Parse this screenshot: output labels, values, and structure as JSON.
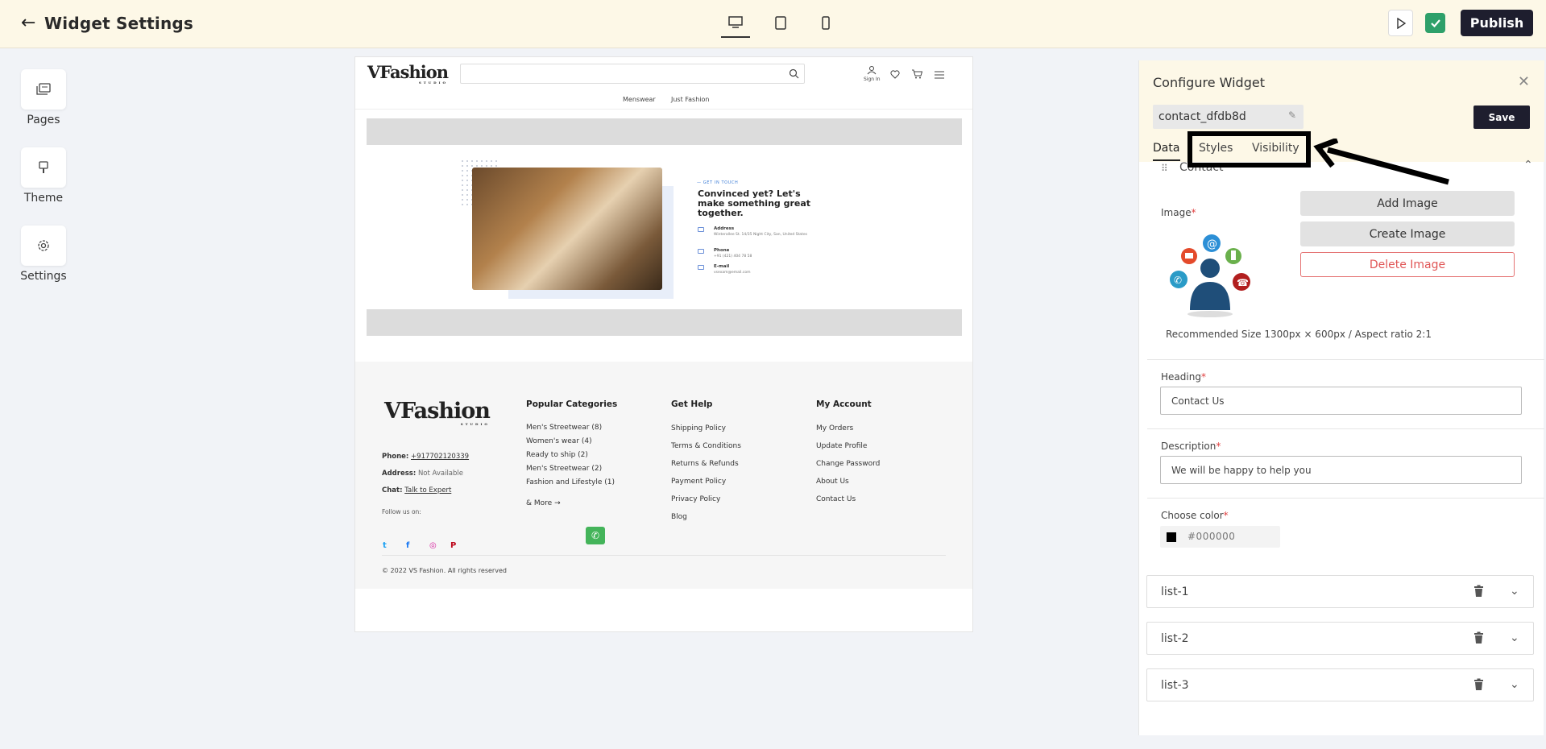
{
  "header": {
    "title": "Widget Settings",
    "publish_label": "Publish"
  },
  "sidebar": {
    "items": [
      {
        "label": "Pages"
      },
      {
        "label": "Theme"
      },
      {
        "label": "Settings"
      }
    ]
  },
  "preview": {
    "logo": "VFashion",
    "logo_sub": "STUDIO",
    "user_label": "Sign In",
    "menu": [
      "Menswear",
      "Just Fashion"
    ],
    "contact": {
      "eyebrow": "— GET IN TOUCH",
      "heading": "Convinced yet? Let's make something great together.",
      "address_label": "Address",
      "address_value": "Winterallee St. 14/35 Night City, San, United States",
      "phone_label": "Phone",
      "phone_value": "+91 (421) 404 78 58",
      "email_label": "E-mail",
      "email_value": "vsexam@email.com"
    },
    "footer": {
      "phone_label": "Phone:",
      "phone_value": "+917702120339",
      "address_label": "Address:",
      "address_value": "Not Available",
      "chat_label": "Chat:",
      "chat_value": "Talk to Expert",
      "follow_label": "Follow us on:",
      "col1_title": "Popular Categories",
      "col1_items": [
        "Men's Streetwear (8)",
        "Women's wear (4)",
        "Ready to ship (2)",
        "Men's Streetwear (2)",
        "Fashion and Lifestyle (1)"
      ],
      "more_label": "& More",
      "col2_title": "Get Help",
      "col2_items": [
        "Shipping Policy",
        "Terms & Conditions",
        "Returns & Refunds",
        "Payment Policy",
        "Privacy Policy",
        "Blog"
      ],
      "col3_title": "My Account",
      "col3_items": [
        "My Orders",
        "Update Profile",
        "Change Password",
        "About Us",
        "Contact Us"
      ],
      "copyright": "© 2022 VS Fashion. All rights reserved"
    }
  },
  "panel": {
    "title": "Configure Widget",
    "widget_name": "contact_dfdb8d",
    "save_label": "Save",
    "tabs": [
      "Data",
      "Styles",
      "Visibility"
    ],
    "section": "Contact",
    "image_label": "Image",
    "add_image": "Add Image",
    "create_image": "Create Image",
    "delete_image": "Delete Image",
    "recommended": "Recommended Size 1300px × 600px / Aspect ratio 2:1",
    "heading_label": "Heading",
    "heading_value": "Contact Us",
    "description_label": "Description",
    "description_value": "We will be happy to help you",
    "color_label": "Choose color",
    "color_value": "#000000",
    "lists": [
      "list-1",
      "list-2",
      "list-3"
    ]
  },
  "colors": {
    "topbar_bg": "#fdf8e7",
    "publish_bg": "#1e1e2e",
    "check_green": "#2ea06a",
    "delete_red": "#e05555",
    "whatsapp_green": "#44b45a"
  }
}
